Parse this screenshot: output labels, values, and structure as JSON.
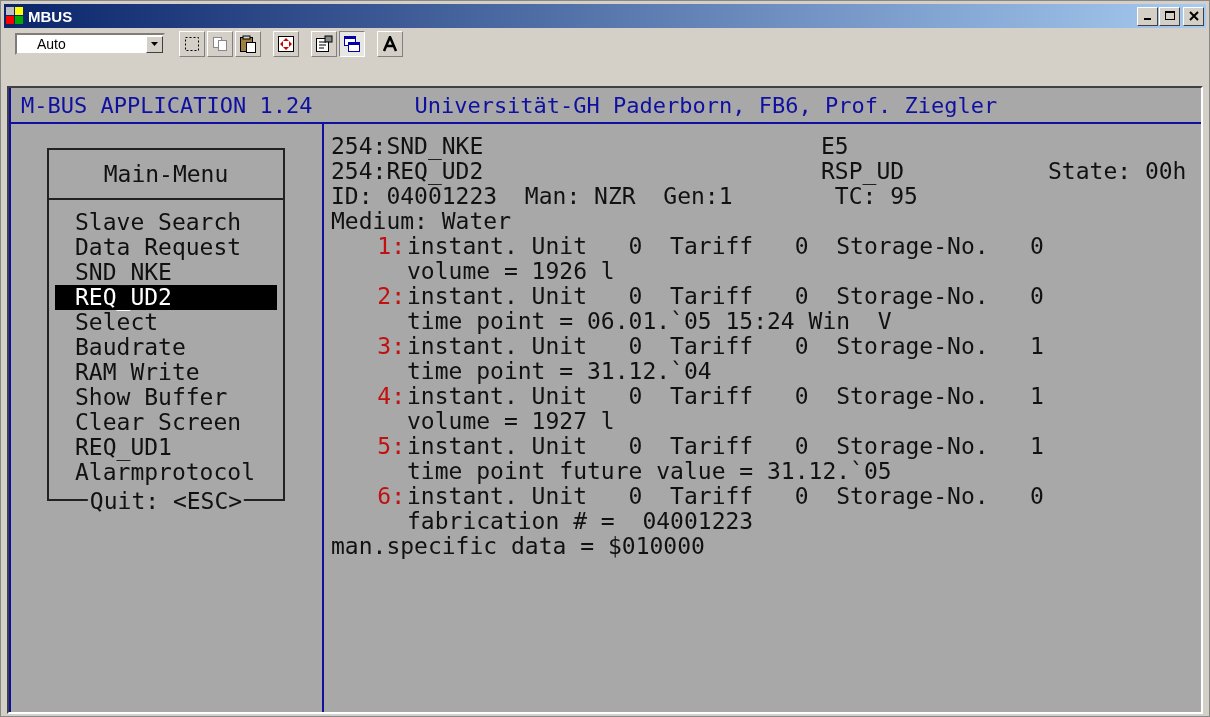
{
  "window": {
    "title": "MBUS"
  },
  "toolbar": {
    "font_size": "Auto"
  },
  "header": {
    "application": "M-BUS APPLICATION 1.24",
    "institution": "Universität-GH Paderborn, FB6, Prof. Ziegler"
  },
  "menu": {
    "title": "Main-Menu",
    "footer": "Quit: <ESC>",
    "items": [
      {
        "label": "Slave Search",
        "selected": false
      },
      {
        "label": "Data Request",
        "selected": false
      },
      {
        "label": "SND_NKE",
        "selected": false
      },
      {
        "label": "REQ_UD2",
        "selected": true
      },
      {
        "label": "Select",
        "selected": false
      },
      {
        "label": "Baudrate",
        "selected": false
      },
      {
        "label": "RAM Write",
        "selected": false
      },
      {
        "label": "Show Buffer",
        "selected": false
      },
      {
        "label": "Clear Screen",
        "selected": false
      },
      {
        "label": "REQ_UD1",
        "selected": false
      },
      {
        "label": "Alarmprotocol",
        "selected": false
      }
    ]
  },
  "telegram": {
    "lines": [
      {
        "left": "254:SND_NKE",
        "middle": "E5"
      },
      {
        "left": "254:REQ_UD2",
        "middle": "RSP_UD",
        "right": "State: 00h"
      },
      {
        "left": "ID: 04001223  Man: NZR  Gen:1",
        "middle": " TC: 95"
      },
      {
        "left": "Medium: Water"
      }
    ],
    "records": [
      {
        "number": "1:",
        "info": "instant. Unit   0  Tariff   0  Storage-No.   0",
        "value": "volume = 1926 l"
      },
      {
        "number": "2:",
        "info": "instant. Unit   0  Tariff   0  Storage-No.   0",
        "value": "time point = 06.01.`05 15:24 Win  V"
      },
      {
        "number": "3:",
        "info": "instant. Unit   0  Tariff   0  Storage-No.   1",
        "value": "time point = 31.12.`04"
      },
      {
        "number": "4:",
        "info": "instant. Unit   0  Tariff   0  Storage-No.   1",
        "value": "volume = 1927 l"
      },
      {
        "number": "5:",
        "info": "instant. Unit   0  Tariff   0  Storage-No.   1",
        "value": "time point future value = 31.12.`05"
      },
      {
        "number": "6:",
        "info": "instant. Unit   0  Tariff   0  Storage-No.   0",
        "value": "fabrication # =  04001223"
      }
    ],
    "footer": "man.specific data = $010000"
  }
}
